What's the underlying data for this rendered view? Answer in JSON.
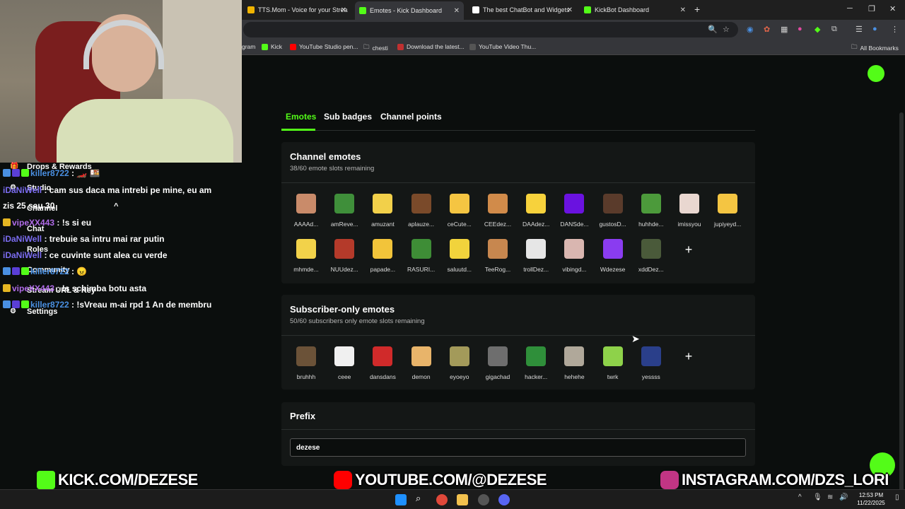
{
  "browser": {
    "tabs": [
      {
        "label": "TTS.Mom - Voice for your Strea",
        "color": "#f0b400"
      },
      {
        "label": "Emotes - Kick Dashboard",
        "color": "#53fc18"
      },
      {
        "label": "The best ChatBot and Widgets",
        "color": "#ffffff"
      },
      {
        "label": "KickBot Dashboard",
        "color": "#53fc18"
      }
    ],
    "bookmarks": [
      {
        "label": "gram"
      },
      {
        "label": "Kick"
      },
      {
        "label": "YouTube Studio pen..."
      },
      {
        "label": "chesti"
      },
      {
        "label": "Download the latest..."
      },
      {
        "label": "YouTube Video Thu..."
      }
    ],
    "all_bookmarks": "All Bookmarks"
  },
  "page": {
    "tabs": [
      "Emotes",
      "Sub badges",
      "Channel points"
    ],
    "channel_emotes": {
      "title": "Channel emotes",
      "subtitle": "38/60 emote slots remaining",
      "emotes": [
        {
          "name": "AAAAd...",
          "color": "#c98b6a"
        },
        {
          "name": "amReve...",
          "color": "#3f8f3a"
        },
        {
          "name": "amuzant",
          "color": "#f2d04a"
        },
        {
          "name": "aplauze...",
          "color": "#7a4a2a"
        },
        {
          "name": "ceCute...",
          "color": "#f5c542"
        },
        {
          "name": "CEEdez...",
          "color": "#d18b4a"
        },
        {
          "name": "DAAdez...",
          "color": "#f7d23c"
        },
        {
          "name": "DANSde...",
          "color": "#6a12e0"
        },
        {
          "name": "gustosD...",
          "color": "#5a3b2b"
        },
        {
          "name": "huhhde...",
          "color": "#4c9a3b"
        },
        {
          "name": "imissyou",
          "color": "#e9d7d0"
        },
        {
          "name": "jupiyeyd...",
          "color": "#f4c542"
        },
        {
          "name": "mhmde...",
          "color": "#f2d24a"
        },
        {
          "name": "NUUdez...",
          "color": "#b43a2a"
        },
        {
          "name": "papade...",
          "color": "#f2c43a"
        },
        {
          "name": "RASURI...",
          "color": "#3e8d36"
        },
        {
          "name": "saluutd...",
          "color": "#f1d33c"
        },
        {
          "name": "TeeRog...",
          "color": "#c7874f"
        },
        {
          "name": "trollDez...",
          "color": "#e6e6e6"
        },
        {
          "name": "vibingd...",
          "color": "#d9b6b0"
        },
        {
          "name": "Wdezese",
          "color": "#8a3cf0"
        },
        {
          "name": "xddDez...",
          "color": "#4a5a3a"
        }
      ]
    },
    "sub_emotes": {
      "title": "Subscriber-only emotes",
      "subtitle": "50/60 subscribers only emote slots remaining",
      "emotes": [
        {
          "name": "bruhhh",
          "color": "#6b5238"
        },
        {
          "name": "ceee",
          "color": "#f0f0f0"
        },
        {
          "name": "dansdans",
          "color": "#d02a2a"
        },
        {
          "name": "demon",
          "color": "#e8b46a"
        },
        {
          "name": "eyoeyo",
          "color": "#a39a5a"
        },
        {
          "name": "gigachad",
          "color": "#6e6e6e"
        },
        {
          "name": "hacker...",
          "color": "#2f8f3a"
        },
        {
          "name": "hehehe",
          "color": "#b0a89a"
        },
        {
          "name": "twrk",
          "color": "#8ed24a"
        },
        {
          "name": "yessss",
          "color": "#2a3f8a"
        }
      ]
    },
    "prefix": {
      "title": "Prefix",
      "value": "dezese"
    }
  },
  "overlay": {
    "menu": [
      {
        "label": "Drops & Rewards",
        "icon": "gift-icon"
      },
      {
        "label": "Studio",
        "icon": "settings-icon"
      },
      {
        "label": "Channel",
        "icon": "none"
      },
      {
        "label": "Chat",
        "icon": "none"
      },
      {
        "label": "Roles",
        "icon": "none"
      },
      {
        "label": "Community",
        "icon": "none"
      },
      {
        "label": "Stream URL & Key",
        "icon": "none"
      },
      {
        "label": "Settings",
        "icon": "gear-icon"
      }
    ],
    "chat": [
      {
        "user": "killer8722",
        "text": " : 🏎️ 🍱",
        "user_color": "#4a90e2",
        "badges": [
          "#4a90e2",
          "#5a3fd6",
          "#53fc18"
        ]
      },
      {
        "user": "iDaNiWell",
        "text": " : cam sus daca ma intrebi pe mine, eu am",
        "user_color": "#7b6cf0",
        "badges": []
      },
      {
        "user": "",
        "text": "zis 25 sau 30",
        "user_color": "#fff",
        "badges": []
      },
      {
        "user": "vipeXX443",
        "text": " : !s si eu",
        "user_color": "#b06be8",
        "badges": [
          "#e5b622"
        ]
      },
      {
        "user": "iDaNiWell",
        "text": " : trebuie sa intru mai rar putin",
        "user_color": "#7b6cf0",
        "badges": []
      },
      {
        "user": "iDaNiWell",
        "text": " : ce cuvinte sunt alea cu verde",
        "user_color": "#7b6cf0",
        "badges": []
      },
      {
        "user": "killer8722",
        "text": " : 😠",
        "user_color": "#4a90e2",
        "badges": [
          "#4a90e2",
          "#5a3fd6",
          "#53fc18"
        ]
      },
      {
        "user": "vipeXX443",
        "text": " : !s schimba botu asta",
        "user_color": "#b06be8",
        "badges": [
          "#e5b622"
        ]
      },
      {
        "user": "killer8722",
        "text": " : !sVreau m-ai rpd 1 An de membru",
        "user_color": "#4a90e2",
        "badges": [
          "#4a90e2",
          "#5a3fd6",
          "#53fc18"
        ]
      }
    ],
    "banners": [
      {
        "text": "KICK.COM/DEZESE",
        "color": "#53fc18"
      },
      {
        "text": "YOUTUBE.COM/@DEZESE",
        "color": "#ff0000"
      },
      {
        "text": "INSTAGRAM.COM/DZS_LORI",
        "color": "#c13584"
      }
    ]
  },
  "taskbar": {
    "time": "12:53 PM",
    "date": "11/22/2025"
  }
}
